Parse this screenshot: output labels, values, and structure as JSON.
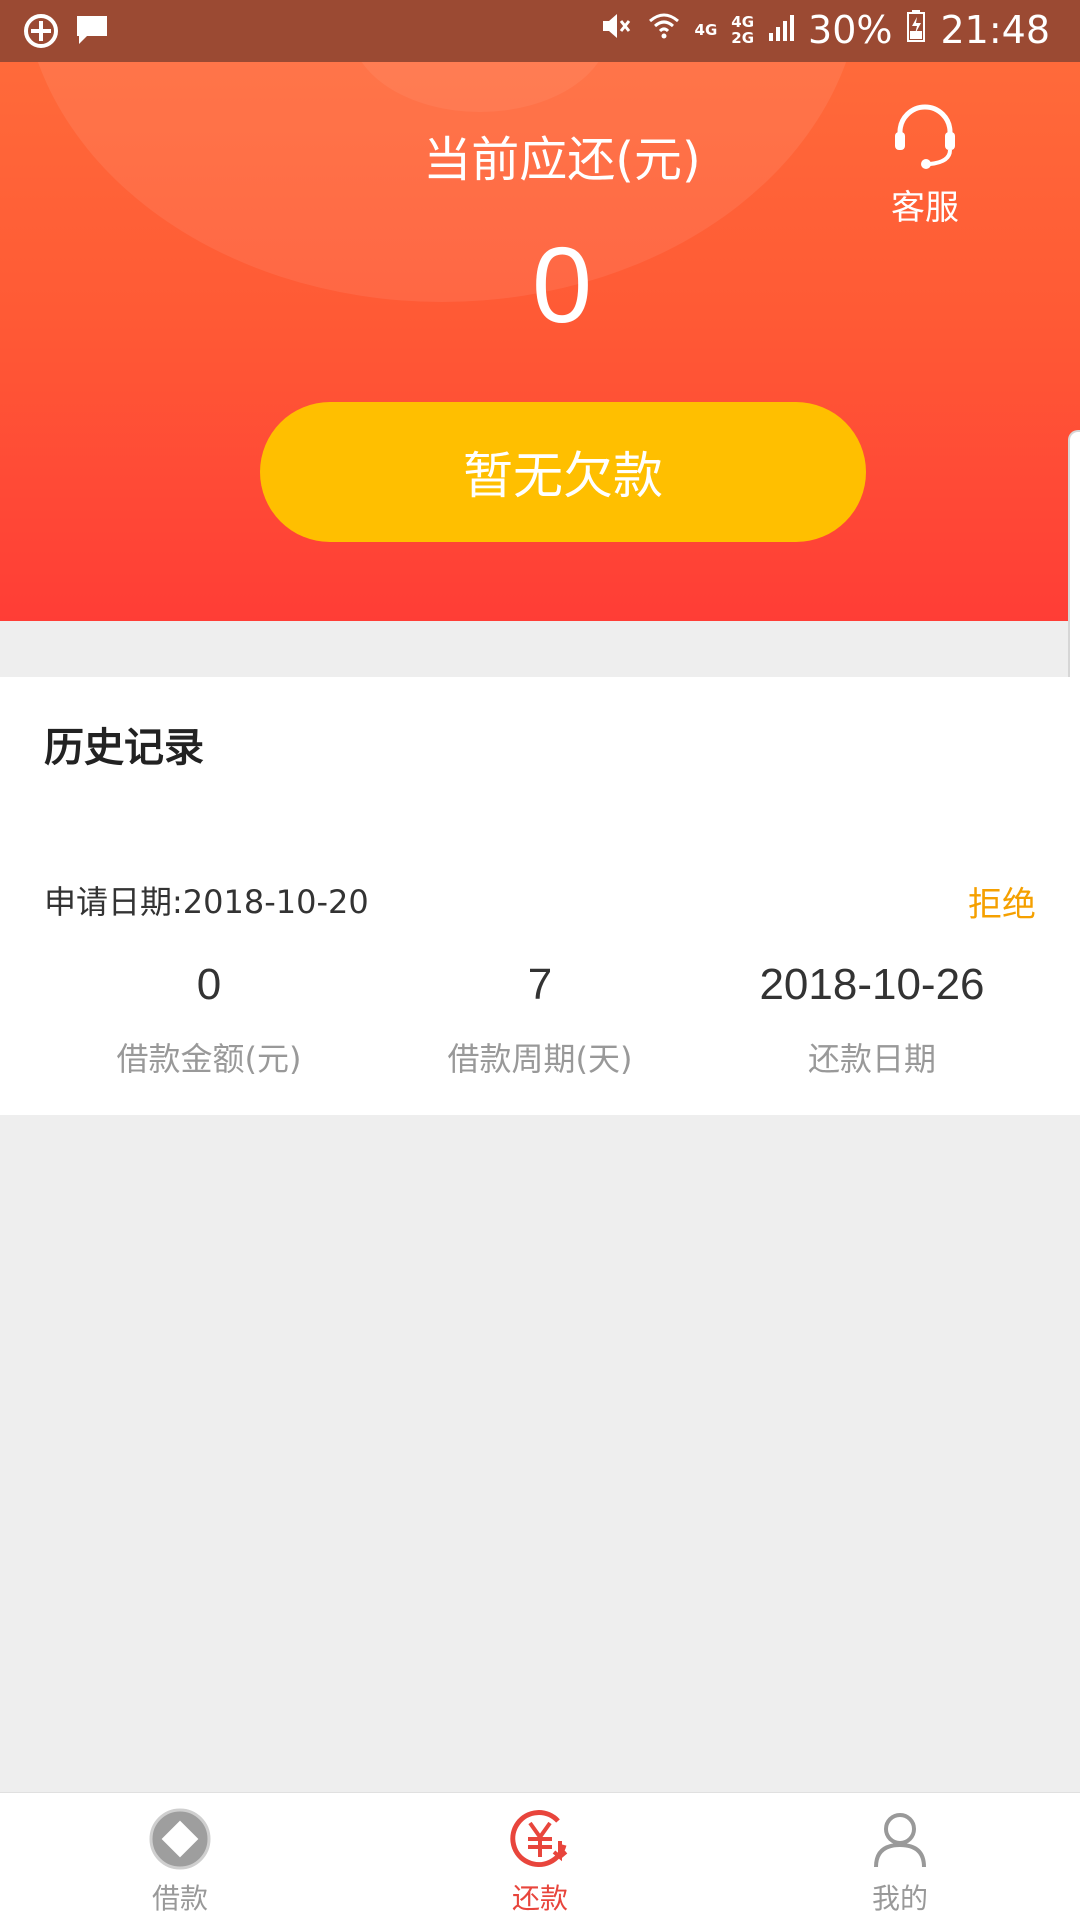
{
  "status_bar": {
    "network_top": "4G",
    "network_dual_top": "4G",
    "network_dual_bottom": "2G",
    "battery": "30%",
    "time": "21:48"
  },
  "hero": {
    "title": "当前应还(元)",
    "amount": "0",
    "button_label": "暂无欠款",
    "service_label": "客服"
  },
  "history": {
    "title": "历史记录",
    "records": [
      {
        "apply_date": "申请日期:2018-10-20",
        "status": "拒绝",
        "amount": "0",
        "amount_label": "借款金额(元)",
        "period": "7",
        "period_label": "借款周期(天)",
        "repay_date": "2018-10-26",
        "repay_date_label": "还款日期"
      }
    ]
  },
  "tabbar": {
    "items": [
      {
        "label": "借款",
        "icon": "loan-diamond-icon",
        "active": false
      },
      {
        "label": "还款",
        "icon": "repay-yuan-icon",
        "active": true
      },
      {
        "label": "我的",
        "icon": "user-icon",
        "active": false
      }
    ]
  },
  "colors": {
    "hero_top": "#ff6a3a",
    "hero_bottom": "#ff3d36",
    "button": "#ffbf00",
    "status_rejected": "#f5a000",
    "tab_active": "#e8453c",
    "tab_inactive": "#999999"
  }
}
